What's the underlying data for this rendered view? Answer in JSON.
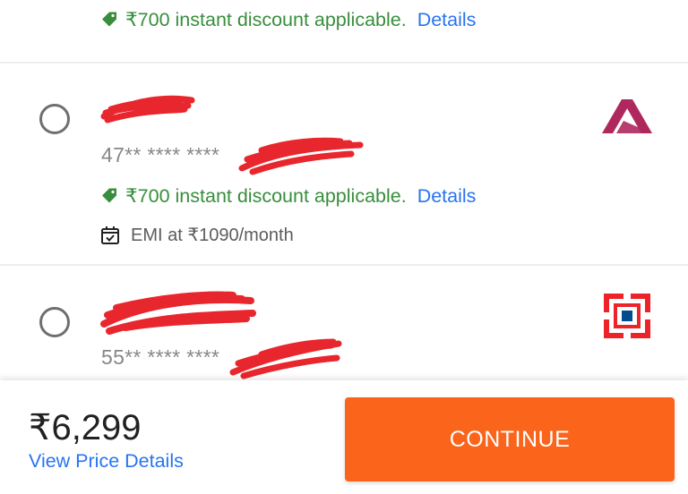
{
  "offers": {
    "text": "₹700 instant discount applicable.",
    "details_label": "Details"
  },
  "cards": [
    {
      "name": "",
      "number": "47** **** ****",
      "emi": "EMI at ₹1090/month",
      "bank_icon": "axis-bank-logo",
      "bank_color": "#ae285d"
    },
    {
      "name": "",
      "number": "55** **** ****",
      "bank_icon": "hdfc-bank-logo",
      "bank_color": "#ed232a"
    }
  ],
  "footer": {
    "price": "₹6,299",
    "view_price_details": "View Price Details",
    "continue_label": "CONTINUE"
  },
  "colors": {
    "offer_green": "#388e3c",
    "link_blue": "#2874f0",
    "cta_orange": "#fb641b",
    "redaction_red": "#e8262d"
  }
}
